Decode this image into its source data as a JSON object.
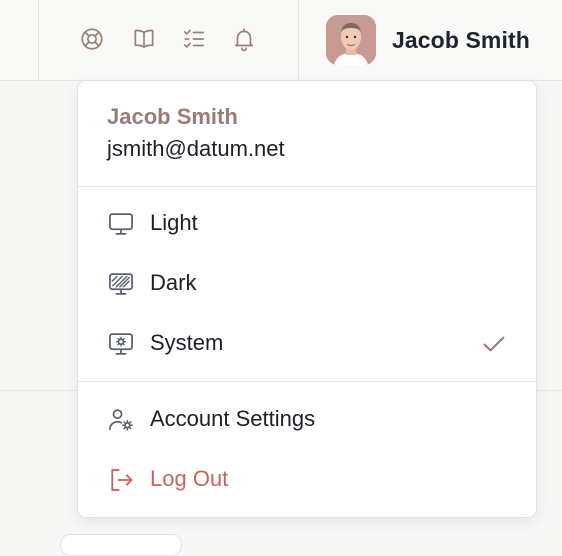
{
  "topbar": {
    "icons": [
      {
        "name": "help-lifebuoy-icon"
      },
      {
        "name": "docs-book-icon"
      },
      {
        "name": "tasks-checklist-icon"
      },
      {
        "name": "notifications-bell-icon"
      }
    ],
    "user_name": "Jacob Smith"
  },
  "menu": {
    "name": "Jacob Smith",
    "email": "jsmith@datum.net",
    "themes": [
      {
        "label": "Light",
        "icon": "monitor-icon",
        "selected": false
      },
      {
        "label": "Dark",
        "icon": "monitor-dark-icon",
        "selected": false
      },
      {
        "label": "System",
        "icon": "monitor-system-icon",
        "selected": true
      }
    ],
    "account_settings": "Account Settings",
    "logout": "Log Out"
  },
  "colors": {
    "accent_name": "#9a7b76",
    "logout": "#c9645a",
    "icon_topbar": "#9c807b",
    "icon_menu": "#5a6070"
  }
}
